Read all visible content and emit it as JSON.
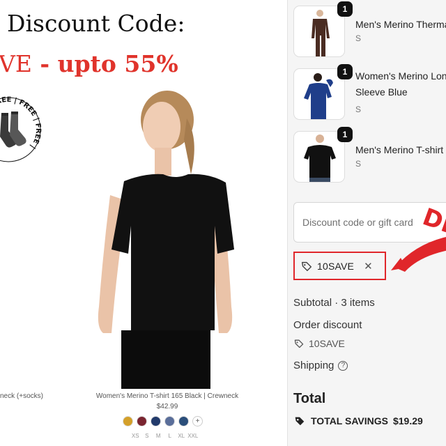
{
  "promo": {
    "headline": "Discount Code:",
    "code_fragment": "VE",
    "discount_text": " - upto 55%",
    "badge_text": "FREE | FREE | FREE | FREE |"
  },
  "product": {
    "prev_name": "neck (+socks)",
    "name": "Women's Merino T-shirt 165 Black | Crewneck",
    "price": "$42.99",
    "swatch_colors": [
      "#d4a02a",
      "#7a2530",
      "#223a6b",
      "#5a6e9a",
      "#2b4e7a"
    ],
    "swatch_more": "+",
    "sizes": [
      "XS",
      "S",
      "M",
      "L",
      "XL",
      "XXL"
    ]
  },
  "cart": {
    "items": [
      {
        "qty": "1",
        "name": "Men's Merino Thermal",
        "variant": "S"
      },
      {
        "qty": "1",
        "name": "Women's Merino Long Sleeve Blue",
        "variant": "S"
      },
      {
        "qty": "1",
        "name": "Men's Merino T-shirt",
        "variant": "S"
      }
    ],
    "discount_placeholder": "Discount code or gift card",
    "applied_code": "10SAVE",
    "remove_symbol": "✕",
    "subtotal_label": "Subtotal · 3 items",
    "order_discount_label": "Order discount",
    "order_discount_code": "10SAVE",
    "shipping_label": "Shipping",
    "help_symbol": "?",
    "total_label": "Total",
    "savings_label": "TOTAL SAVINGS",
    "savings_value": "$19.29"
  },
  "overlay": {
    "stamp_text": "DI"
  },
  "colors": {
    "promo_red": "#e0332b",
    "highlight_red": "#e0262a",
    "panel_bg": "#f5f5f5"
  }
}
